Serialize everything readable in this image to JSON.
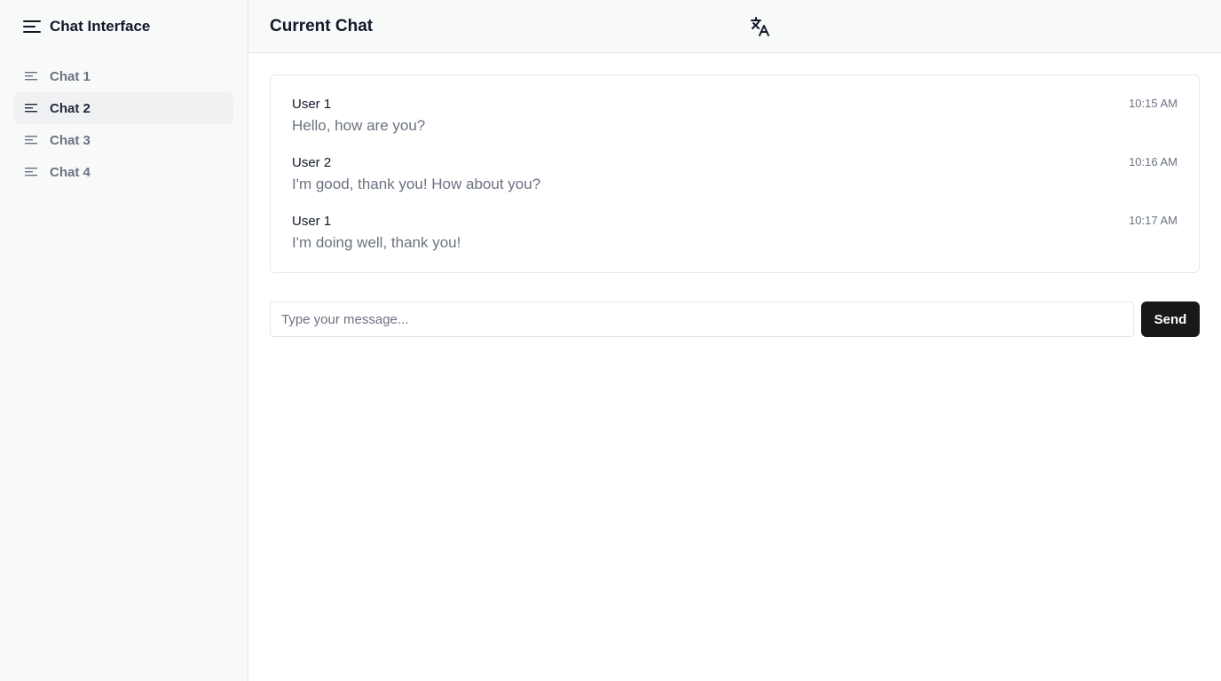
{
  "sidebar": {
    "title": "Chat Interface",
    "menu_icon": "menu-icon",
    "items": [
      {
        "label": "Chat 1",
        "icon": "lines-icon",
        "active": false
      },
      {
        "label": "Chat 2",
        "icon": "lines-icon",
        "active": true
      },
      {
        "label": "Chat 3",
        "icon": "lines-icon",
        "active": false
      },
      {
        "label": "Chat 4",
        "icon": "lines-icon",
        "active": false
      }
    ]
  },
  "header": {
    "title": "Current Chat",
    "translate_icon": "translate-icon"
  },
  "messages": [
    {
      "sender": "User 1",
      "text": "Hello, how are you?",
      "time": "10:15 AM"
    },
    {
      "sender": "User 2",
      "text": "I'm good, thank you! How about you?",
      "time": "10:16 AM"
    },
    {
      "sender": "User 1",
      "text": "I'm doing well, thank you!",
      "time": "10:17 AM"
    }
  ],
  "composer": {
    "placeholder": "Type your message...",
    "value": "",
    "send_label": "Send"
  },
  "colors": {
    "sidebar_bg": "#f8f9f9",
    "active_item_bg": "#f0f1f3",
    "send_button_bg": "#18181b",
    "muted_text": "#6b7280"
  }
}
